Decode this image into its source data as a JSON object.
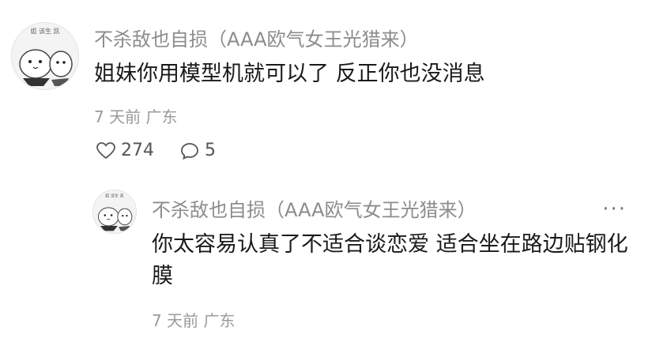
{
  "comment": {
    "username": "不杀敌也自损（AAA欧气女王光猎来）",
    "text": "姐妹你用模型机就可以了 反正你也没消息",
    "time": "7 天前",
    "location": "广东",
    "likes": "274",
    "replies": "5",
    "avatar_text": "姐 该生 凯",
    "icons": {
      "like": "heart-outline-icon",
      "reply": "chat-bubble-icon"
    }
  },
  "reply": {
    "username": "不杀敌也自损（AAA欧气女王光猎来）",
    "text": "你太容易认真了不适合谈恋爱 适合坐在路边贴钢化膜",
    "time": "7 天前",
    "location": "广东",
    "more": "···",
    "avatar_text": "姐 该生 凯"
  }
}
